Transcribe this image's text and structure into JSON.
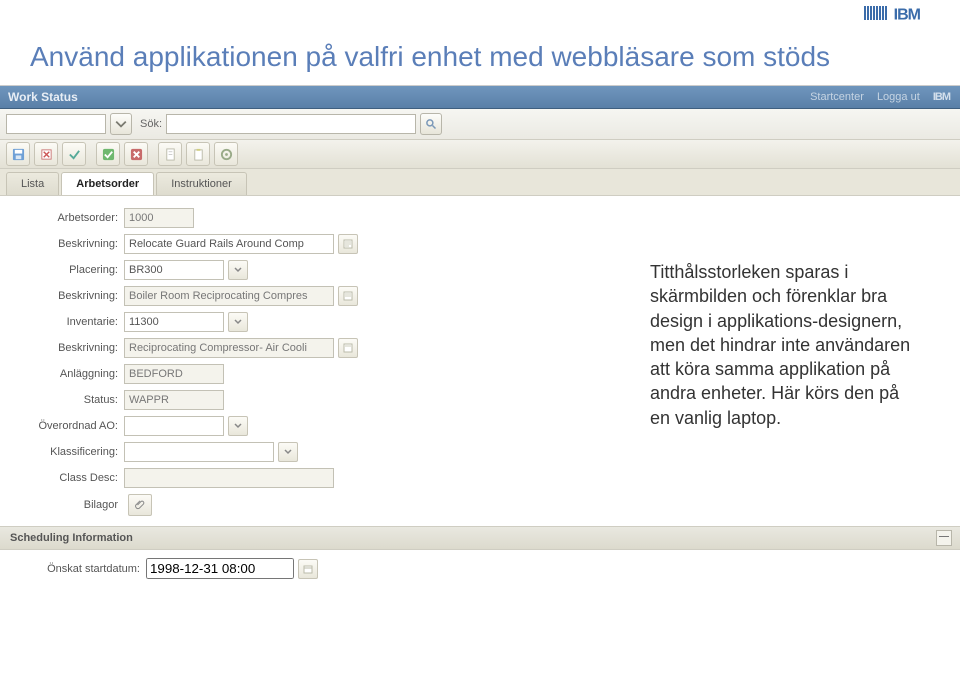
{
  "slide": {
    "title": "Använd applikationen på valfri enhet med webbläsare som stöds"
  },
  "brand": "IBM",
  "titlebar": {
    "appname": "Work Status",
    "links": {
      "start": "Startcenter",
      "logout": "Logga ut"
    }
  },
  "search": {
    "label": "Sök:",
    "field1": "",
    "field2": ""
  },
  "tabs": {
    "list": "Lista",
    "work": "Arbetsorder",
    "instr": "Instruktioner"
  },
  "form": {
    "arbetsorder_label": "Arbetsorder:",
    "arbetsorder": "1000",
    "beskrivning_label": "Beskrivning:",
    "beskrivning1": "Relocate Guard Rails Around Comp",
    "placering_label": "Placering:",
    "placering": "BR300",
    "beskrivning2": "Boiler Room Reciprocating Compres",
    "inventarie_label": "Inventarie:",
    "inventarie": "11300",
    "beskrivning3": "Reciprocating Compressor- Air Cooli",
    "anlaggning_label": "Anläggning:",
    "anlaggning": "BEDFORD",
    "status_label": "Status:",
    "status": "WAPPR",
    "overordnad_label": "Överordnad AO:",
    "overordnad": "",
    "klass_label": "Klassificering:",
    "klass": "",
    "classdesc_label": "Class Desc:",
    "classdesc": "",
    "bilagor_label": "Bilagor"
  },
  "section": {
    "scheduling": "Scheduling Information",
    "startdate_label": "Önskat startdatum:",
    "startdate": "1998-12-31 08:00"
  },
  "note": "Titthålsstorleken sparas i skärmbilden och förenklar bra design i applikations-designern, men det hindrar inte användaren att köra samma applikation på andra enheter. Här körs den på en vanlig laptop."
}
